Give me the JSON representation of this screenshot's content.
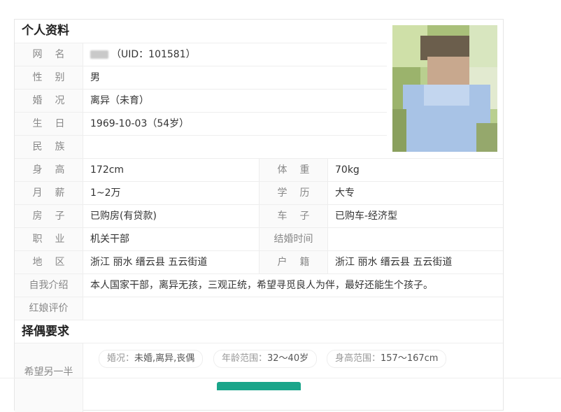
{
  "profile": {
    "section_title": "个人资料",
    "nickname_uid": "（UID：101581）",
    "fields": {
      "nickname": {
        "label": "网名"
      },
      "gender": {
        "label": "性别",
        "value": "男"
      },
      "marital": {
        "label": "婚况",
        "value": "离异（未育）"
      },
      "birthday": {
        "label": "生日",
        "value": "1969-10-03（54岁）"
      },
      "ethnicity": {
        "label": "民族",
        "value": ""
      },
      "height": {
        "label": "身高",
        "value": "172cm"
      },
      "weight": {
        "label": "体重",
        "value": "70kg"
      },
      "salary": {
        "label": "月薪",
        "value": "1~2万"
      },
      "education": {
        "label": "学历",
        "value": "大专"
      },
      "house": {
        "label": "房子",
        "value": "已购房(有贷款)"
      },
      "car": {
        "label": "车子",
        "value": "已购车-经济型"
      },
      "job": {
        "label": "职业",
        "value": "机关干部"
      },
      "wedding_time": {
        "label": "结婚时间",
        "value": ""
      },
      "region": {
        "label": "地区",
        "value": "浙江 丽水 缙云县 五云街道"
      },
      "hukou": {
        "label": "户籍",
        "value": "浙江 丽水 缙云县 五云街道"
      },
      "intro": {
        "label": "自我介绍",
        "value": "本人国家干部，离异无孩，三观正统，希望寻觅良人为伴，最好还能生个孩子。"
      },
      "matchmaker": {
        "label": "红娘评价",
        "value": ""
      }
    }
  },
  "requirements": {
    "section_title": "择偶要求",
    "label": "希望另一半",
    "tags": [
      {
        "key": "婚况：",
        "value": "未婚,离异,丧偶"
      },
      {
        "key": "年龄范围：",
        "value": "32～40岁"
      },
      {
        "key": "身高范围：",
        "value": "157～167cm"
      }
    ]
  },
  "colors": {
    "accent": "#1aa58a",
    "label_bg": "#fafafa",
    "border": "#eeeeee"
  }
}
